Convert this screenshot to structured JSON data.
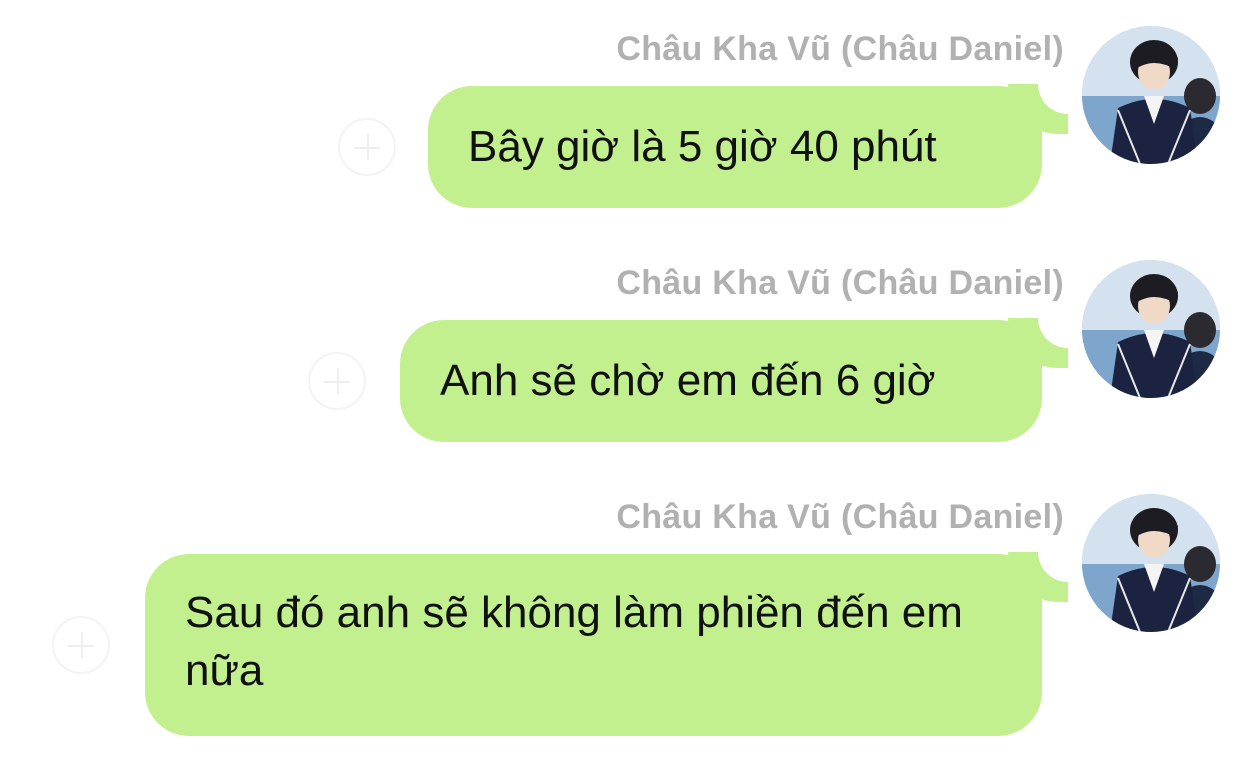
{
  "messages": [
    {
      "sender": "Châu Kha Vũ (Châu Daniel)",
      "text": "Bây giờ là 5 giờ 40 phút",
      "avatar_icon": "profile-photo-icon",
      "action_icon": "add-circle-icon"
    },
    {
      "sender": "Châu Kha Vũ (Châu Daniel)",
      "text": "Anh sẽ chờ em đến 6 giờ",
      "avatar_icon": "profile-photo-icon",
      "action_icon": "add-circle-icon"
    },
    {
      "sender": "Châu Kha Vũ (Châu Daniel)",
      "text": "Sau đó anh sẽ không làm phiền đến em nữa",
      "avatar_icon": "profile-photo-icon",
      "action_icon": "add-circle-icon"
    }
  ],
  "colors": {
    "bubble": "#c2f08e",
    "sender_name": "#b1b1b1",
    "text": "#111111",
    "background": "#ffffff"
  }
}
